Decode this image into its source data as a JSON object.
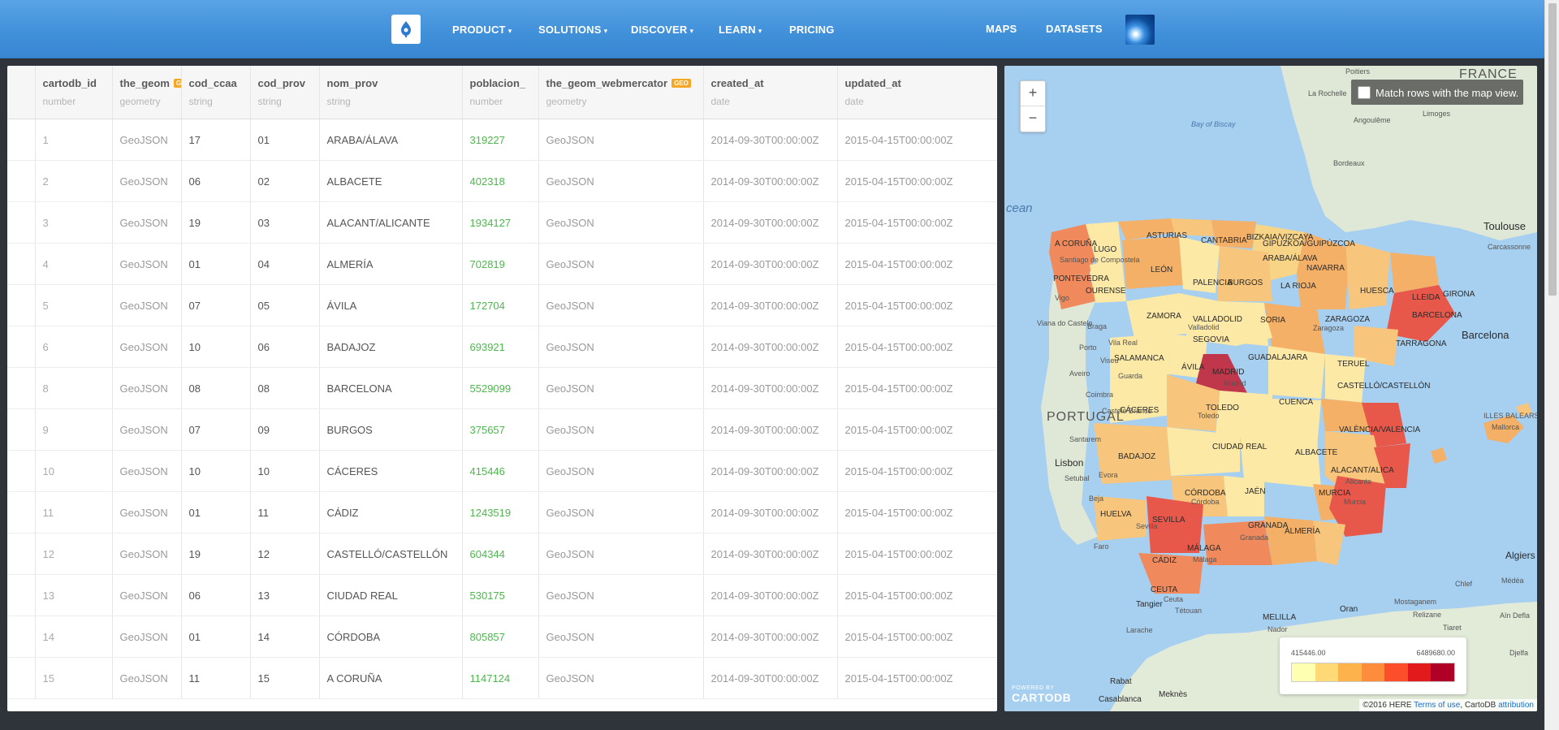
{
  "nav": {
    "items": [
      {
        "label": "PRODUCT",
        "dropdown": true
      },
      {
        "label": "SOLUTIONS",
        "dropdown": true
      },
      {
        "label": "DISCOVER",
        "dropdown": true
      },
      {
        "label": "LEARN",
        "dropdown": true
      },
      {
        "label": "PRICING",
        "dropdown": false
      }
    ],
    "right_items": [
      {
        "label": "MAPS"
      },
      {
        "label": "DATASETS"
      }
    ],
    "logo_icon": "cartodb-logo-icon",
    "avatar_icon": "globe-avatar-icon"
  },
  "table": {
    "columns": [
      {
        "name": "cartodb_id",
        "type": "number",
        "geo": false
      },
      {
        "name": "the_geom",
        "type": "geometry",
        "geo": true,
        "badge": "GEO"
      },
      {
        "name": "cod_ccaa",
        "type": "string",
        "geo": false
      },
      {
        "name": "cod_prov",
        "type": "string",
        "geo": false
      },
      {
        "name": "nom_prov",
        "type": "string",
        "geo": false
      },
      {
        "name": "poblacion_",
        "type": "number",
        "geo": false
      },
      {
        "name": "the_geom_webmercator",
        "type": "geometry",
        "geo": true,
        "badge": "GEO"
      },
      {
        "name": "created_at",
        "type": "date",
        "geo": false
      },
      {
        "name": "updated_at",
        "type": "date",
        "geo": false
      }
    ],
    "rows": [
      [
        "1",
        "GeoJSON",
        "17",
        "01",
        "ARABA/ÁLAVA",
        "319227",
        "GeoJSON",
        "2014-09-30T00:00:00Z",
        "2015-04-15T00:00:00Z"
      ],
      [
        "2",
        "GeoJSON",
        "06",
        "02",
        "ALBACETE",
        "402318",
        "GeoJSON",
        "2014-09-30T00:00:00Z",
        "2015-04-15T00:00:00Z"
      ],
      [
        "3",
        "GeoJSON",
        "19",
        "03",
        "ALACANT/ALICANTE",
        "1934127",
        "GeoJSON",
        "2014-09-30T00:00:00Z",
        "2015-04-15T00:00:00Z"
      ],
      [
        "4",
        "GeoJSON",
        "01",
        "04",
        "ALMERÍA",
        "702819",
        "GeoJSON",
        "2014-09-30T00:00:00Z",
        "2015-04-15T00:00:00Z"
      ],
      [
        "5",
        "GeoJSON",
        "07",
        "05",
        "ÁVILA",
        "172704",
        "GeoJSON",
        "2014-09-30T00:00:00Z",
        "2015-04-15T00:00:00Z"
      ],
      [
        "6",
        "GeoJSON",
        "10",
        "06",
        "BADAJOZ",
        "693921",
        "GeoJSON",
        "2014-09-30T00:00:00Z",
        "2015-04-15T00:00:00Z"
      ],
      [
        "8",
        "GeoJSON",
        "08",
        "08",
        "BARCELONA",
        "5529099",
        "GeoJSON",
        "2014-09-30T00:00:00Z",
        "2015-04-15T00:00:00Z"
      ],
      [
        "9",
        "GeoJSON",
        "07",
        "09",
        "BURGOS",
        "375657",
        "GeoJSON",
        "2014-09-30T00:00:00Z",
        "2015-04-15T00:00:00Z"
      ],
      [
        "10",
        "GeoJSON",
        "10",
        "10",
        "CÁCERES",
        "415446",
        "GeoJSON",
        "2014-09-30T00:00:00Z",
        "2015-04-15T00:00:00Z"
      ],
      [
        "11",
        "GeoJSON",
        "01",
        "11",
        "CÁDIZ",
        "1243519",
        "GeoJSON",
        "2014-09-30T00:00:00Z",
        "2015-04-15T00:00:00Z"
      ],
      [
        "12",
        "GeoJSON",
        "19",
        "12",
        "CASTELLÓ/CASTELLÓN",
        "604344",
        "GeoJSON",
        "2014-09-30T00:00:00Z",
        "2015-04-15T00:00:00Z"
      ],
      [
        "13",
        "GeoJSON",
        "06",
        "13",
        "CIUDAD REAL",
        "530175",
        "GeoJSON",
        "2014-09-30T00:00:00Z",
        "2015-04-15T00:00:00Z"
      ],
      [
        "14",
        "GeoJSON",
        "01",
        "14",
        "CÓRDOBA",
        "805857",
        "GeoJSON",
        "2014-09-30T00:00:00Z",
        "2015-04-15T00:00:00Z"
      ],
      [
        "15",
        "GeoJSON",
        "11",
        "15",
        "A CORUÑA",
        "1147124",
        "GeoJSON",
        "2014-09-30T00:00:00Z",
        "2015-04-15T00:00:00Z"
      ]
    ]
  },
  "map": {
    "zoom_in": "+",
    "zoom_out": "−",
    "match_rows_label": "Match rows with the map view.",
    "legend": {
      "min": "415446.00",
      "max": "6489680.00",
      "colors": [
        "#ffffb2",
        "#fed976",
        "#feb24c",
        "#fd8d3c",
        "#fc4e2a",
        "#e31a1c",
        "#b10026"
      ]
    },
    "powered_by": "POWERED BY",
    "brand": "CARTODB",
    "attribution": {
      "copyright": "©2016 HERE",
      "terms": "Terms of use",
      "separator": ",",
      "cartodb": "CartoDB",
      "link": "attribution"
    },
    "labels": {
      "countries": [
        "FRANCE",
        "PORTUGAL"
      ],
      "water": [
        "Bay of Biscay",
        "cean"
      ],
      "provinces": [
        "A CORUÑA",
        "LUGO",
        "ASTURIAS",
        "CANTABRIA",
        "BIZKAIA/VIZCAYA",
        "GIPUZKOA/GUIPÚZCOA",
        "PONTEVEDRA",
        "OURENSE",
        "LEÓN",
        "ARABA/ÁLAVA",
        "NAVARRA",
        "PALENCIA",
        "BURGOS",
        "LA RIOJA",
        "HUESCA",
        "LLEIDA",
        "GIRONA",
        "ZAMORA",
        "VALLADOLID",
        "SORIA",
        "ZARAGOZA",
        "BARCELONA",
        "SEGOVIA",
        "SALAMANCA",
        "ÁVILA",
        "MADRID",
        "GUADALAJARA",
        "TERUEL",
        "TARRAGONA",
        "CASTELLÓ/CASTELLÓN",
        "CÁCERES",
        "TOLEDO",
        "CUENCA",
        "ILLES BALEARS",
        "VALÈNCIA/VALENCIA",
        "BADAJOZ",
        "CIUDAD REAL",
        "ALBACETE",
        "ALACANT/ALICA",
        "CÓRDOBA",
        "JAÉN",
        "MURCIA",
        "HUELVA",
        "SEVILLA",
        "GRANADA",
        "ALMERÍA",
        "MÁLAGA",
        "CÁDIZ",
        "CEUTA",
        "MELILLA"
      ],
      "cities": [
        "Poitiers",
        "La Rochelle",
        "Angoulême",
        "Limoges",
        "Bordeaux",
        "Toulouse",
        "Carcassonne",
        "Barcelona",
        "Madrid",
        "Lisbon",
        "Setubal",
        "Porto",
        "Coimbra",
        "Braga",
        "Valladolid",
        "Zaragoza",
        "Toledo",
        "Córdoba",
        "Sevilla",
        "Málaga",
        "Granada",
        "Murcia",
        "Alicante",
        "Mallorca",
        "Algiers",
        "Médéa",
        "Chlef",
        "Mostaganem",
        "Oran",
        "Relizane",
        "Tiaret",
        "Tangier",
        "Tétouan",
        "Larache",
        "Nador",
        "Rabat",
        "Casablanca",
        "Meknès",
        "Djelfa",
        "Aïn Defla",
        "Ceuta",
        "Faro",
        "Santarem",
        "Evora",
        "Beja",
        "Vigo",
        "Santiago de Compostela",
        "Viana do Castelo",
        "Vila Real",
        "Aveiro",
        "Viseu",
        "Guarda",
        "Castelo Branco"
      ]
    }
  }
}
